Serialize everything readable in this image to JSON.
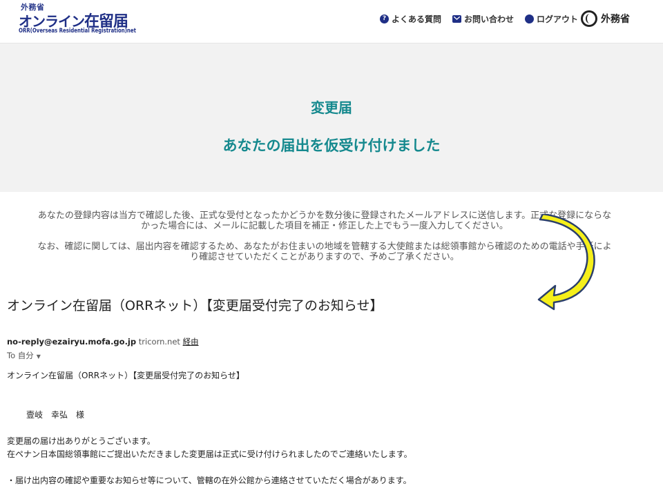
{
  "header": {
    "logo": {
      "ministry": "外務省",
      "main_prefix": "オンライン",
      "main_suffix": "在留届",
      "sub": "ORR(Overseas Residential Registration)net"
    },
    "nav": {
      "faq": "よくある質問",
      "contact": "お問い合わせ",
      "logout": "ログアウト",
      "ministry": "外務省"
    }
  },
  "banner": {
    "title": "変更届",
    "subtitle": "あなたの届出を仮受け付けました"
  },
  "notices": {
    "first_line1": "あなたの登録内容は当方で確認した後、正式な受付となったかどうかを数分後に登録されたメールアドレスに送信します。正式な登録にならな",
    "first_line2": "かった場合には、メールに記載した項目を補正・修正した上でもう一度入力してください。",
    "second_line1": "なお、確認に関しては、届出内容を確認するため、あなたがお住まいの地域を管轄する大使館または総領事館から確認のための電話や手紙によ",
    "second_line2": "り確認させていただくことがありますので、予めご了承ください。"
  },
  "email": {
    "subject": "オンライン在留届（ORRネット）【変更届受付完了のお知らせ】",
    "sender": "no-reply@ezairyu.mofa.go.jp",
    "via_domain": "tricorn.net",
    "via_label": "経由",
    "to": "To 自分",
    "body": {
      "line1": "オンライン在留届（ORRネット）【変更届受付完了のお知らせ】",
      "line2": "壹岐　幸弘　様",
      "line3": "変更届の届け出ありがとうございます。",
      "line4": "在ペナン日本国総領事館にご提出いただきました変更届は正式に受け付けられましたのでご連絡いたします。",
      "line5": "・届け出内容の確認や重要なお知らせ等について、管轄の在外公館から連絡させていただく場合があります。"
    }
  },
  "colors": {
    "brand_navy": "#1f2f86",
    "banner_teal": "#15898e",
    "arrow_fill": "#f5ef1a",
    "arrow_stroke": "#2b3f6b"
  },
  "icons": {
    "faq": "question-circle-icon",
    "contact": "mail-icon",
    "logout": "logout-dot-icon",
    "ministry": "mofa-emblem-icon",
    "annotation": "curved-arrow-icon"
  }
}
